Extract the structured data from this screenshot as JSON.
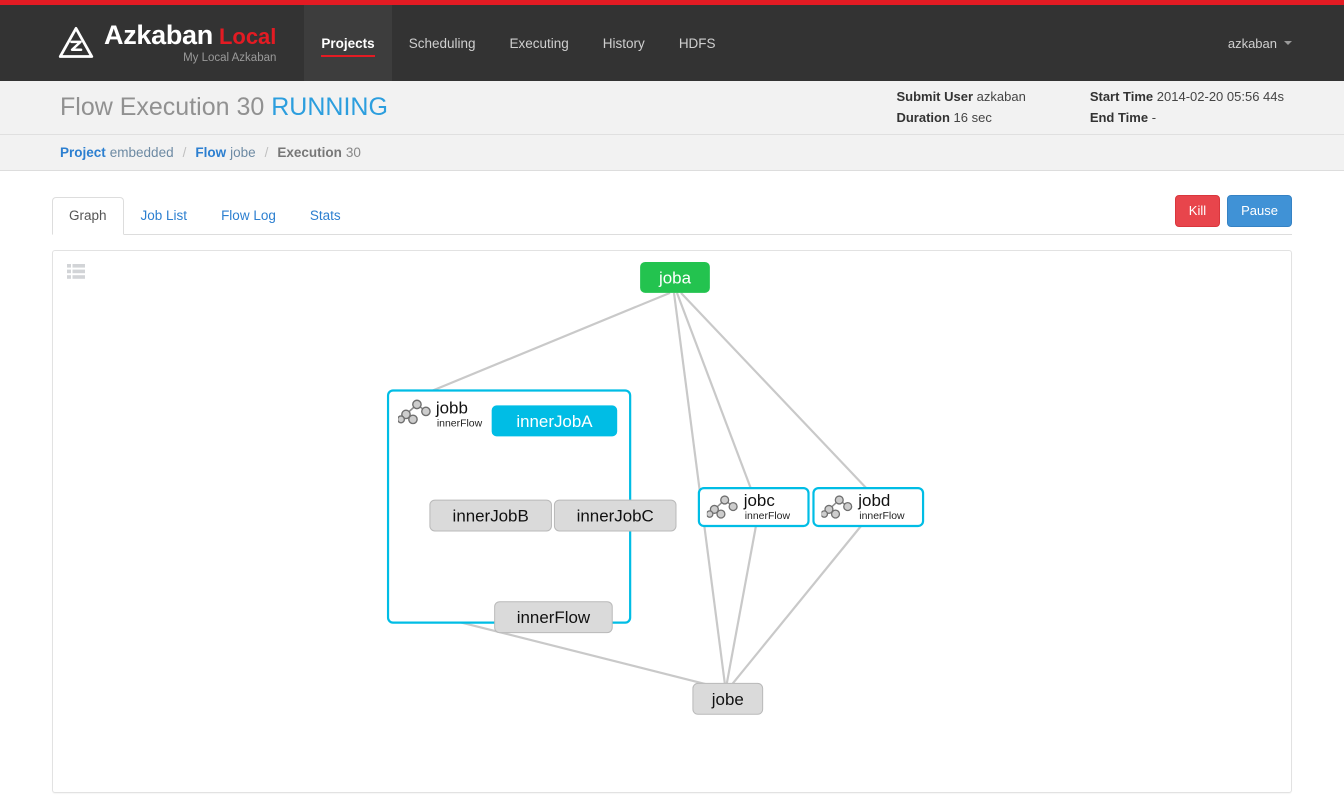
{
  "brand": {
    "name": "Azkaban",
    "edition": "Local",
    "subtitle": "My Local Azkaban",
    "logo_icon": "azkaban-triangle-logo"
  },
  "nav": {
    "items": [
      {
        "label": "Projects",
        "active": true
      },
      {
        "label": "Scheduling",
        "active": false
      },
      {
        "label": "Executing",
        "active": false
      },
      {
        "label": "History",
        "active": false
      },
      {
        "label": "HDFS",
        "active": false
      }
    ],
    "user": "azkaban",
    "user_caret_icon": "chevron-down-icon"
  },
  "header": {
    "title_prefix": "Flow Execution",
    "execution_id": "30",
    "status": "RUNNING",
    "status_color": "#2c9ede",
    "summary": [
      {
        "label": "Submit User",
        "value": "azkaban"
      },
      {
        "label": "Duration",
        "value": "16 sec"
      },
      {
        "label": "Start Time",
        "value": "2014-02-20 05:56 44s"
      },
      {
        "label": "End Time",
        "value": "-"
      }
    ]
  },
  "breadcrumb": {
    "items": [
      {
        "key": "Project",
        "value": "embedded"
      },
      {
        "key": "Flow",
        "value": "jobe"
      },
      {
        "key": "Execution",
        "value": "30"
      }
    ],
    "separator": "/"
  },
  "tabs": [
    {
      "label": "Graph",
      "active": true
    },
    {
      "label": "Job List",
      "active": false
    },
    {
      "label": "Flow Log",
      "active": false
    },
    {
      "label": "Stats",
      "active": false
    }
  ],
  "actions": {
    "kill_label": "Kill",
    "kill_color": "#e8454c",
    "pause_label": "Pause",
    "pause_color": "#4092d6"
  },
  "graph": {
    "toolbar_icon": "list-view-icon",
    "colors": {
      "running": "#00bde5",
      "success": "#23c34f",
      "ready": "#d8d8d8",
      "flow_border": "#00bde5",
      "edge": "#c9c9c9"
    },
    "nodes": [
      {
        "id": "joba",
        "label": "joba",
        "state": "success",
        "type": "job"
      },
      {
        "id": "jobb",
        "label": "jobb",
        "sub": "innerFlow",
        "state": "running",
        "type": "expanded-flow"
      },
      {
        "id": "innerJobA",
        "label": "innerJobA",
        "state": "running",
        "type": "job"
      },
      {
        "id": "innerJobB",
        "label": "innerJobB",
        "state": "ready",
        "type": "job"
      },
      {
        "id": "innerJobC",
        "label": "innerJobC",
        "state": "ready",
        "type": "job"
      },
      {
        "id": "innerFlow",
        "label": "innerFlow",
        "state": "ready",
        "type": "job"
      },
      {
        "id": "jobc",
        "label": "jobc",
        "sub": "innerFlow",
        "state": "running",
        "type": "collapsed-flow"
      },
      {
        "id": "jobd",
        "label": "jobd",
        "sub": "innerFlow",
        "state": "running",
        "type": "collapsed-flow"
      },
      {
        "id": "jobe",
        "label": "jobe",
        "state": "ready",
        "type": "job"
      }
    ],
    "edges": [
      {
        "from": "joba",
        "to": "jobb"
      },
      {
        "from": "joba",
        "to": "jobc"
      },
      {
        "from": "joba",
        "to": "jobd"
      },
      {
        "from": "joba",
        "to": "jobe"
      },
      {
        "from": "innerJobA",
        "to": "innerJobB"
      },
      {
        "from": "innerJobA",
        "to": "innerJobC"
      },
      {
        "from": "innerJobB",
        "to": "innerFlow"
      },
      {
        "from": "innerJobC",
        "to": "innerFlow"
      },
      {
        "from": "jobb",
        "to": "jobe"
      },
      {
        "from": "jobc",
        "to": "jobe"
      },
      {
        "from": "jobd",
        "to": "jobe"
      }
    ]
  }
}
